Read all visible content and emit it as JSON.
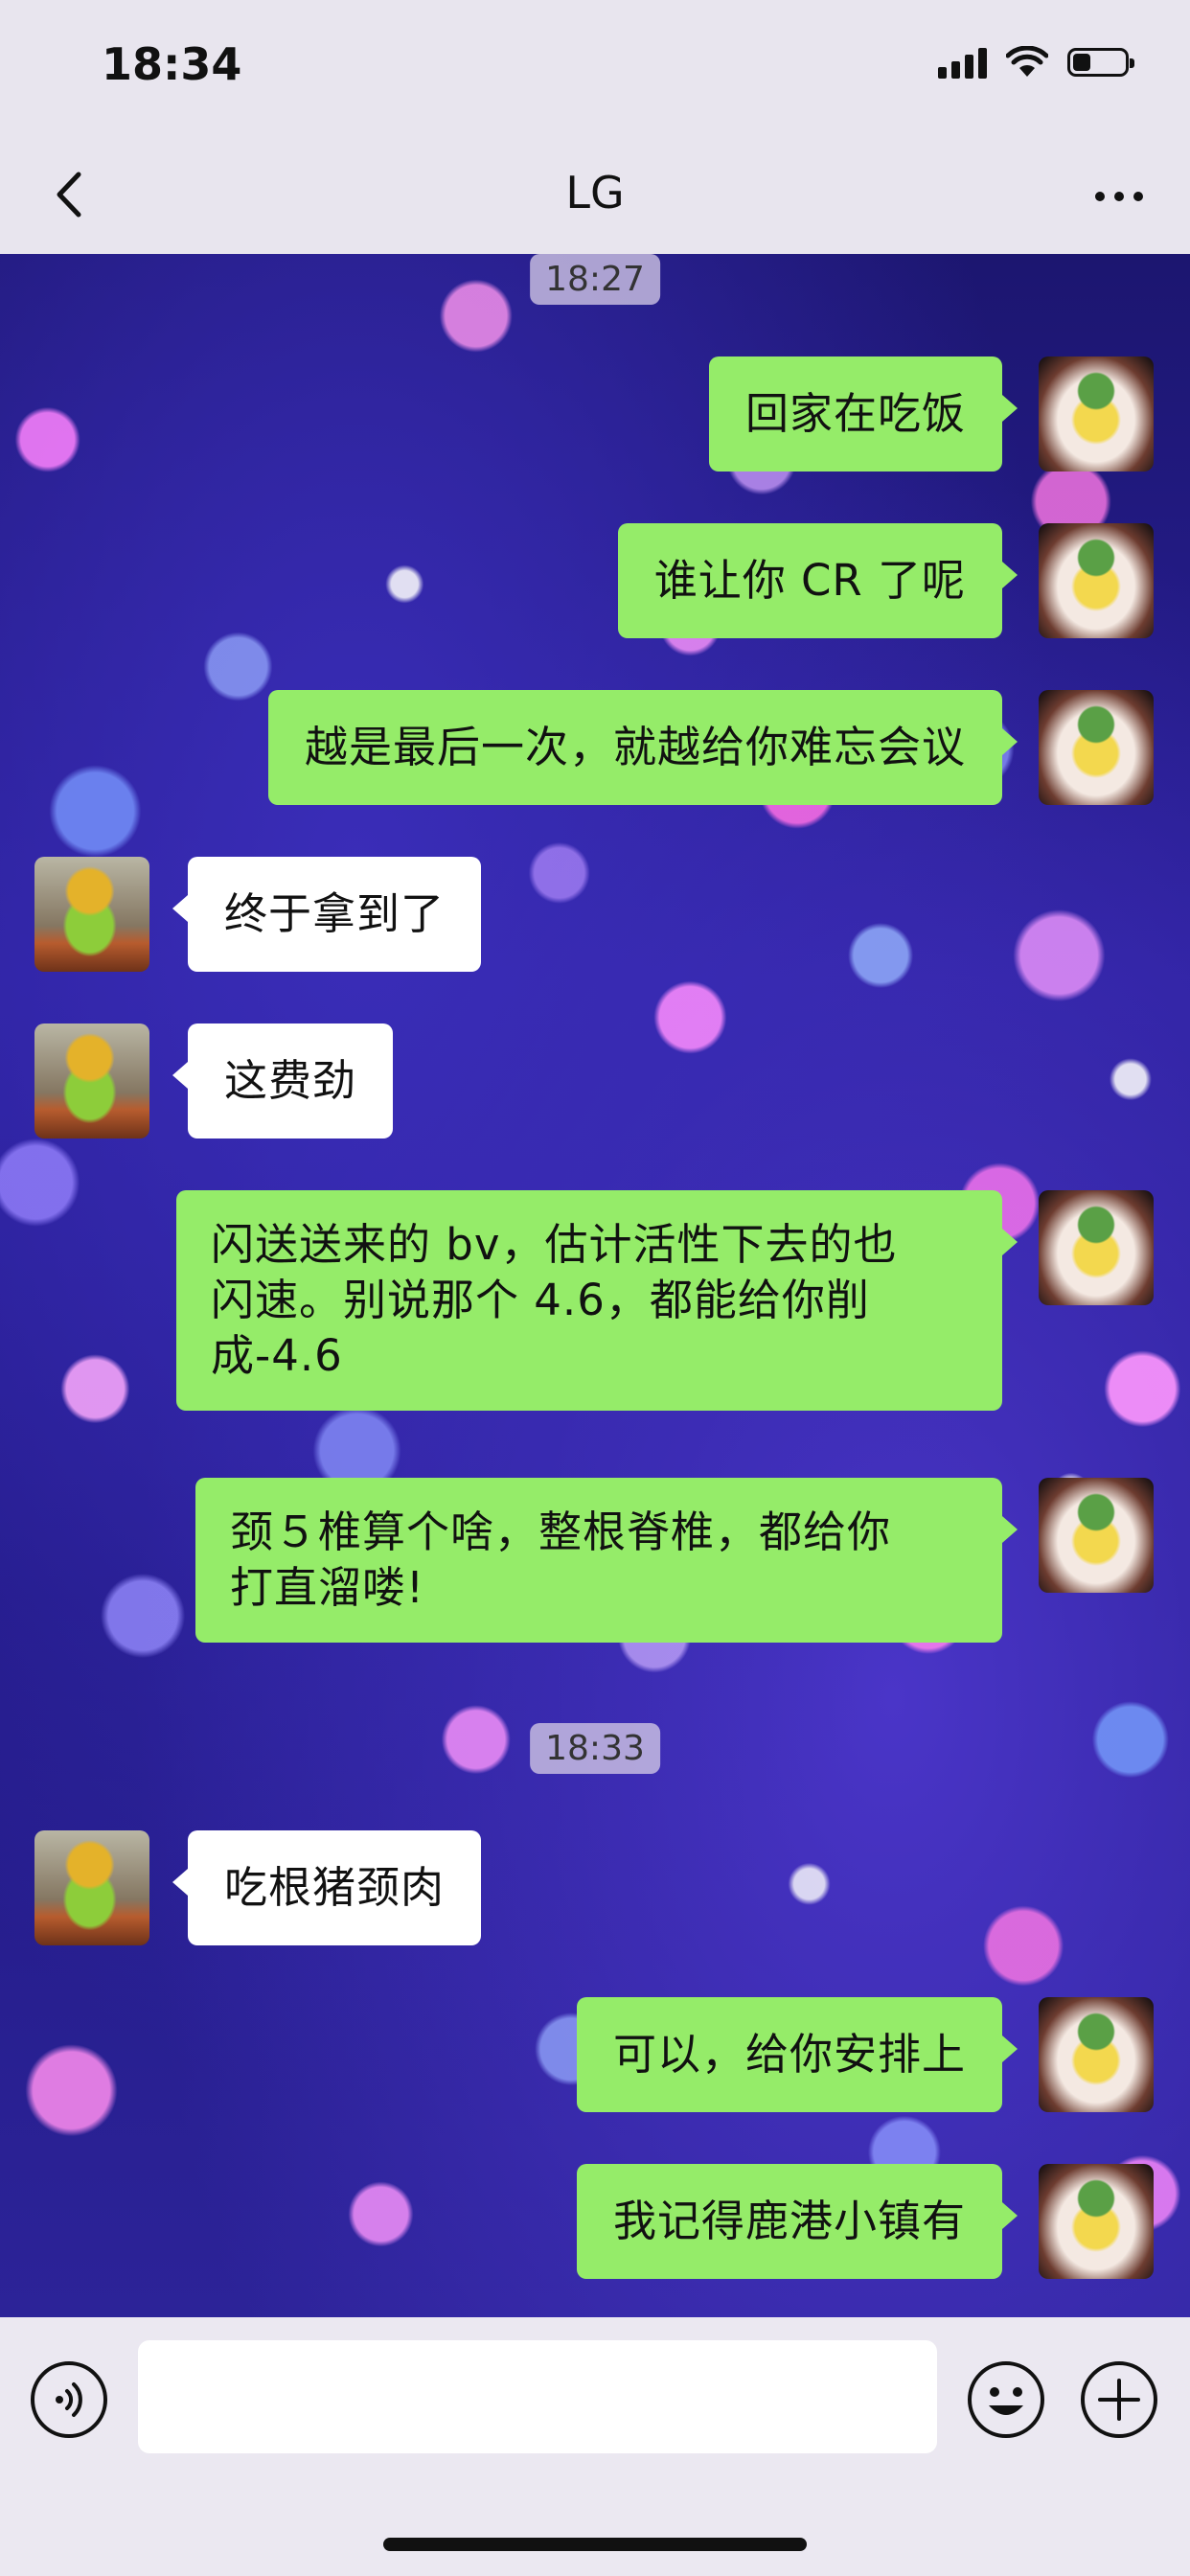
{
  "status_bar": {
    "time": "18:34",
    "icons": [
      "signal-icon",
      "wifi-icon",
      "battery-icon"
    ],
    "battery_level": 0.35
  },
  "nav": {
    "back_icon": "chevron-left-icon",
    "title": "LG",
    "more_icon": "more-dots-icon"
  },
  "chat": {
    "time_1": "18:27",
    "messages_1": [
      {
        "side": "out",
        "text": "回家在吃饭"
      },
      {
        "side": "out",
        "text": "谁让你 CR 了呢"
      },
      {
        "side": "out",
        "text": "越是最后一次，就越给你难忘会议"
      },
      {
        "side": "in",
        "text": "终于拿到了"
      },
      {
        "side": "in",
        "text": "这费劲"
      },
      {
        "side": "out",
        "line1": "闪送送来的 bv，估计活性下去的也",
        "line2": "闪速。别说那个 4.6，都能给你削",
        "line3": "成-4.6"
      },
      {
        "side": "out",
        "line1": "颈５椎算个啥，整根脊椎，都给你",
        "line2": "打直溜喽!"
      }
    ],
    "time_2": "18:33",
    "messages_2": [
      {
        "side": "in",
        "text": "吃根猪颈肉"
      },
      {
        "side": "out",
        "text": "可以，给你安排上"
      },
      {
        "side": "out",
        "text": "我记得鹿港小镇有"
      }
    ]
  },
  "input_bar": {
    "voice_icon": "voice-icon",
    "text_value": "",
    "emoji_icon": "emoji-icon",
    "plus_icon": "plus-circle-icon"
  },
  "colors": {
    "outgoing_bubble": "#95ec69",
    "incoming_bubble": "#ffffff",
    "bar_background": "#e8e5ee"
  }
}
